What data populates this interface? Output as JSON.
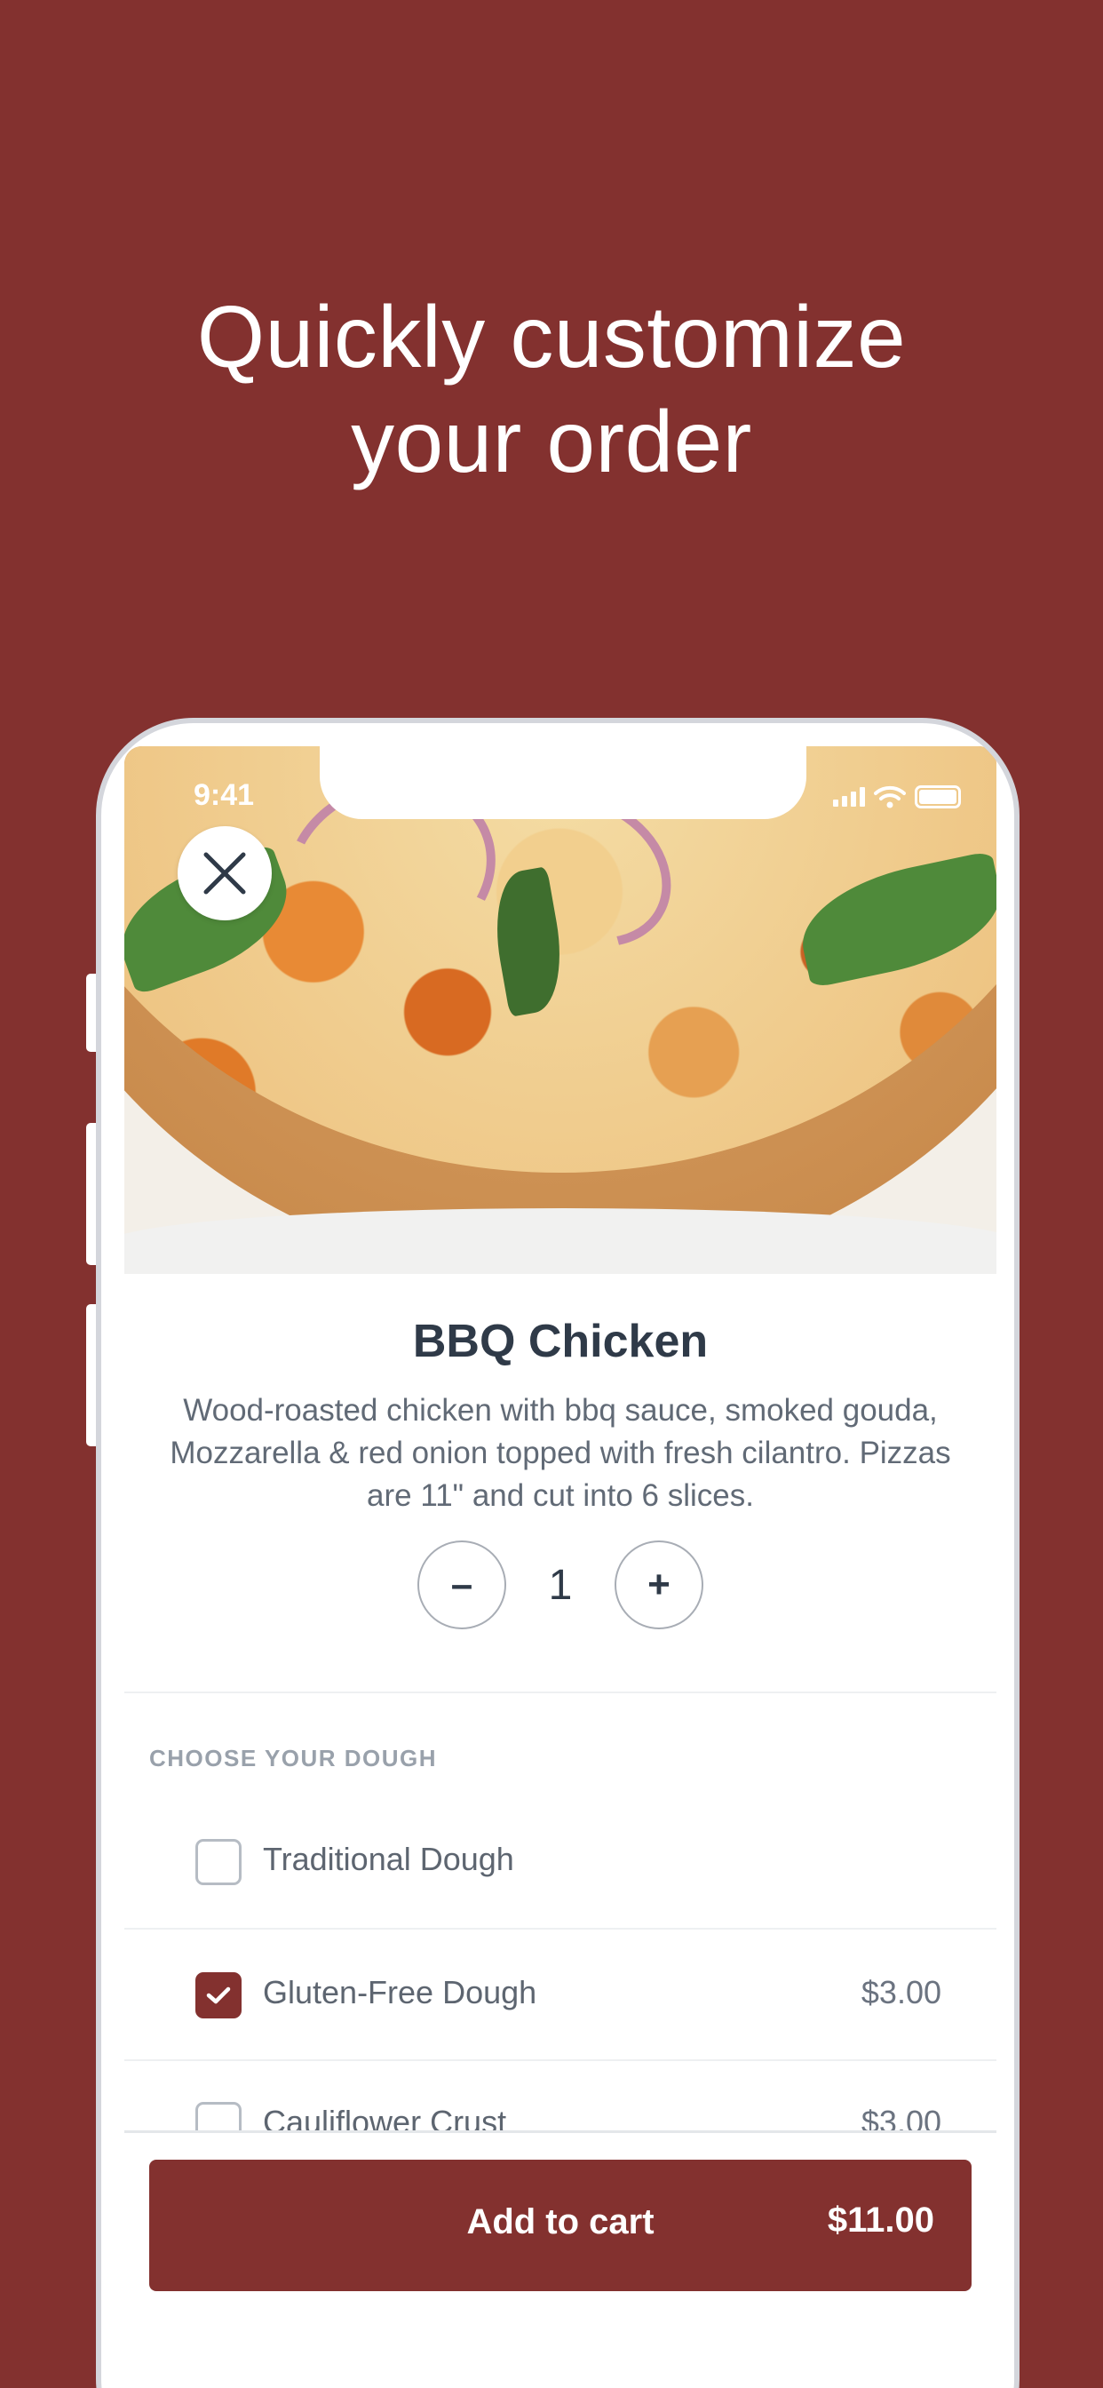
{
  "headline": {
    "line1": "Quickly customize",
    "line2": "your order"
  },
  "status_bar": {
    "time": "9:41"
  },
  "product": {
    "title": "BBQ Chicken",
    "description": "Wood-roasted chicken with bbq sauce, smoked gouda, Mozzarella & red onion topped with fresh cilantro. Pizzas are 11\" and cut into 6 slices.",
    "quantity": "1",
    "decrement_label": "–",
    "increment_label": "+"
  },
  "dough_section": {
    "label": "CHOOSE YOUR DOUGH",
    "options": [
      {
        "label": "Traditional Dough",
        "price": "",
        "checked": false
      },
      {
        "label": "Gluten-Free Dough",
        "price": "$3.00",
        "checked": true
      },
      {
        "label": "Cauliflower Crust",
        "price": "$3.00",
        "checked": false
      }
    ]
  },
  "cart": {
    "button_label": "Add to cart",
    "total": "$11.00"
  },
  "colors": {
    "brand": "#83312f",
    "text_dark": "#2f3a48",
    "text_muted": "#616a76"
  },
  "icons": [
    "close-icon",
    "checkmark-icon",
    "signal-icon",
    "wifi-icon",
    "battery-icon"
  ]
}
